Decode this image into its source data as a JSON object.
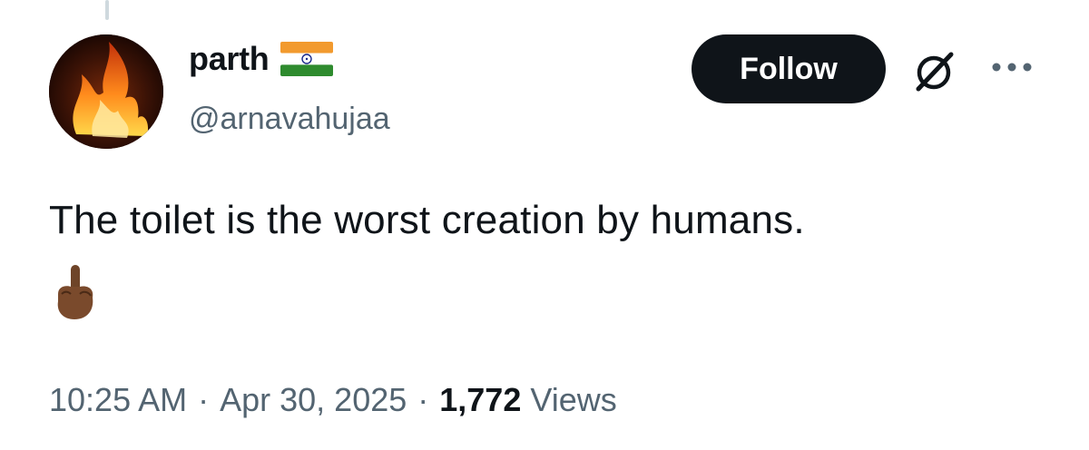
{
  "user": {
    "display_name": "parth",
    "handle": "@arnavahujaa"
  },
  "actions": {
    "follow_label": "Follow"
  },
  "tweet": {
    "text": "The toilet is the worst creation by humans."
  },
  "meta": {
    "time": "10:25 AM",
    "separator": "·",
    "date": "Apr 30, 2025",
    "views_count": "1,772",
    "views_label": "Views"
  },
  "icons": {
    "avatar": "fire-avatar-icon",
    "flag": "india-flag-icon",
    "grok": "grok-icon",
    "more": "more-options-icon",
    "emoji": "middle-finger-emoji-icon"
  },
  "colors": {
    "text_primary": "#0f1419",
    "text_secondary": "#536471",
    "follow_bg": "#0f1419",
    "follow_text": "#ffffff"
  }
}
